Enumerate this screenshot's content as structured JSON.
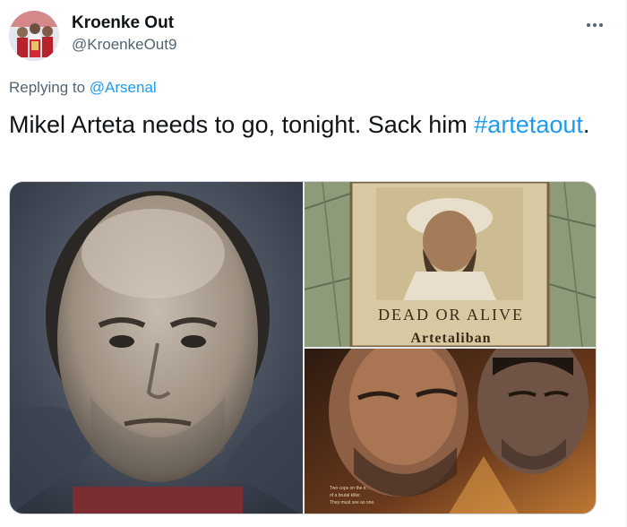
{
  "user": {
    "display_name": "Kroenke Out",
    "handle": "@KroenkeOut9"
  },
  "reply": {
    "prefix": "Replying to ",
    "mention": "@Arsenal"
  },
  "tweet": {
    "text_main": "Mikel Arteta needs to go, tonight. Sack him ",
    "hashtag": "#artetaout",
    "text_end": "."
  },
  "media": {
    "poster_line": "DEAD OR ALIVE",
    "poster_name": "Artetaliban",
    "movie_caption_1": "Two cops on the tr...",
    "movie_caption_2": "of a brutal killer.",
    "movie_caption_3": "They must see as one."
  },
  "icons": {
    "more": "more-horizontal-icon",
    "avatar": "avatar-image"
  },
  "colors": {
    "accent": "#1d9bf0",
    "text": "#0f1419",
    "secondary": "#536471"
  }
}
